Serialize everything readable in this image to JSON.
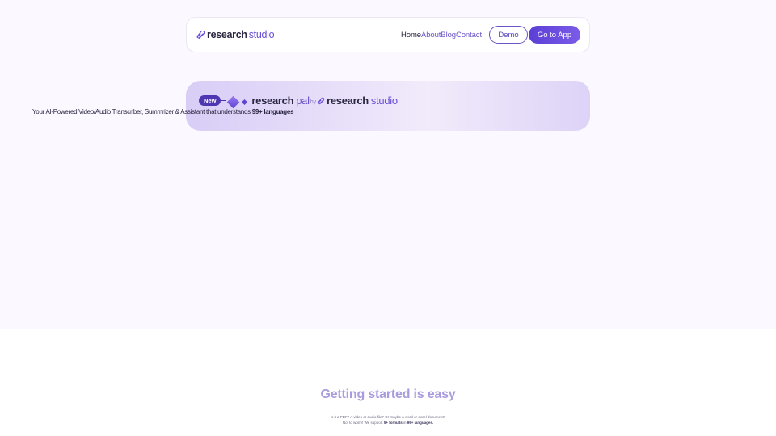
{
  "brand": {
    "research": "research",
    "studio": "studio"
  },
  "nav": {
    "links": [
      "Home",
      "About",
      "Blog",
      "Contact"
    ],
    "demo_label": "Demo",
    "app_label": "Go to App"
  },
  "banner": {
    "badge": "New",
    "pal_research": "research",
    "pal_pal": "pal",
    "by": "by",
    "studio_research": "research",
    "studio_studio": "studio",
    "tagline_prefix": "Your AI-Powered Video/Audio Transcriber, Summrizer & Assistant that understands",
    "tagline_bold": "99+ languages"
  },
  "section": {
    "title": "Getting started is easy",
    "line1": "Is it a PDF? A video or audio file? Or maybe a word or excel document?",
    "line2_prefix": "Not to worry! We support",
    "line2_bold1": "5+ formats",
    "line2_mid": "in",
    "line2_bold2": "99+ languages."
  },
  "colors": {
    "accent": "#6b53c9",
    "accent_dark": "#4e36b3",
    "banner_bg": "#e2d9f8"
  }
}
